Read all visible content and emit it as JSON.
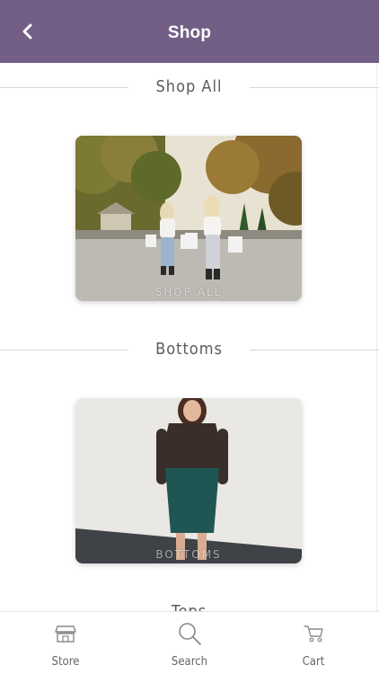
{
  "header": {
    "title": "Shop",
    "back_icon": "chevron-left-icon",
    "background": "#735f86"
  },
  "sections": [
    {
      "heading": "Shop All",
      "card_caption": "SHOP ALL"
    },
    {
      "heading": "Bottoms",
      "card_caption": "BOTTOMS"
    },
    {
      "heading": "Tops"
    }
  ],
  "tabbar": {
    "items": [
      {
        "label": "Store",
        "icon": "store-icon"
      },
      {
        "label": "Search",
        "icon": "search-icon"
      },
      {
        "label": "Cart",
        "icon": "cart-icon"
      }
    ]
  }
}
